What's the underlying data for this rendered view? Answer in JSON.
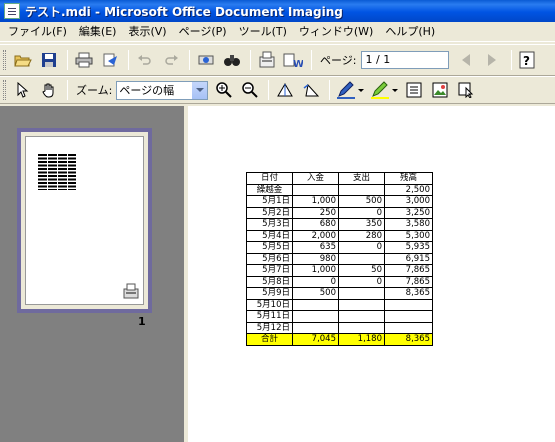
{
  "window": {
    "title": "テスト.mdi - Microsoft Office Document Imaging"
  },
  "menu": [
    "ファイル(F)",
    "編集(E)",
    "表示(V)",
    "ページ(P)",
    "ツール(T)",
    "ウィンドウ(W)",
    "ヘルプ(H)"
  ],
  "toolbar1": {
    "page_label": "ページ:",
    "page_value": "1 / 1"
  },
  "toolbar2": {
    "zoom_label": "ズーム:",
    "zoom_value": "ページの幅"
  },
  "thumbnails": {
    "page_number": "1"
  },
  "sheet": {
    "headers": [
      "日付",
      "入金",
      "支出",
      "残高"
    ],
    "rows": [
      [
        "繰越金",
        "",
        "",
        "2,500"
      ],
      [
        "5月1日",
        "1,000",
        "500",
        "3,000"
      ],
      [
        "5月2日",
        "250",
        "0",
        "3,250"
      ],
      [
        "5月3日",
        "680",
        "350",
        "3,580"
      ],
      [
        "5月4日",
        "2,000",
        "280",
        "5,300"
      ],
      [
        "5月5日",
        "635",
        "0",
        "5,935"
      ],
      [
        "5月6日",
        "980",
        "",
        "6,915"
      ],
      [
        "5月7日",
        "1,000",
        "50",
        "7,865"
      ],
      [
        "5月8日",
        "0",
        "0",
        "7,865"
      ],
      [
        "5月9日",
        "500",
        "",
        "8,365"
      ],
      [
        "5月10日",
        "",
        "",
        ""
      ],
      [
        "5月11日",
        "",
        "",
        ""
      ],
      [
        "5月12日",
        "",
        "",
        ""
      ]
    ],
    "total": [
      "合計",
      "7,045",
      "1,180",
      "8,365"
    ],
    "total_color": "#FFFF00"
  }
}
